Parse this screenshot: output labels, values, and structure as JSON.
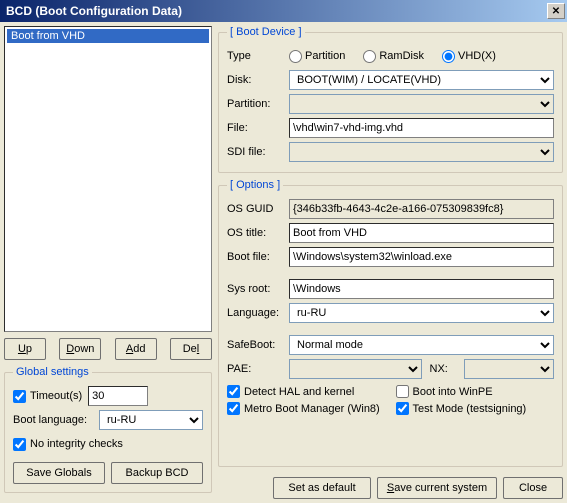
{
  "window": {
    "title": "BCD (Boot Configuration Data)"
  },
  "list": {
    "selected": "Boot from VHD"
  },
  "listButtons": {
    "up": "Up",
    "down": "Down",
    "add": "Add",
    "del": "Del"
  },
  "globalSettings": {
    "legend": "Global settings",
    "timeoutLabel": "Timeout(s)",
    "timeoutValue": "30",
    "timeoutChecked": true,
    "bootLangLabel": "Boot language:",
    "bootLangValue": "ru-RU",
    "noIntegrityLabel": "No integrity checks",
    "noIntegrityChecked": true,
    "saveGlobals": "Save Globals",
    "backupBCD": "Backup BCD"
  },
  "bootDevice": {
    "legend": "[ Boot Device ]",
    "typeLabel": "Type",
    "radios": {
      "partition": "Partition",
      "ramdisk": "RamDisk",
      "vhdx": "VHD(X)"
    },
    "selectedType": "vhdx",
    "diskLabel": "Disk:",
    "diskValue": "BOOT(WIM) / LOCATE(VHD)",
    "partitionLabel": "Partition:",
    "fileLabel": "File:",
    "fileValue": "\\vhd\\win7-vhd-img.vhd",
    "sdiLabel": "SDI file:"
  },
  "options": {
    "legend": "[ Options ]",
    "guidLabel": "OS GUID",
    "guidValue": "{346b33fb-4643-4c2e-a166-075309839fc8}",
    "osTitleLabel": "OS title:",
    "osTitleValue": "Boot from VHD",
    "bootFileLabel": "Boot file:",
    "bootFileValue": "\\Windows\\system32\\winload.exe",
    "sysRootLabel": "Sys root:",
    "sysRootValue": "\\Windows",
    "languageLabel": "Language:",
    "languageValue": "ru-RU",
    "safeBootLabel": "SafeBoot:",
    "safeBootValue": "Normal mode",
    "paeLabel": "PAE:",
    "nxLabel": "NX:",
    "checks": {
      "detectHAL": "Detect HAL and kernel",
      "detectHALChecked": true,
      "bootWinPE": "Boot into WinPE",
      "bootWinPEChecked": false,
      "metroBoot": "Metro Boot Manager (Win8)",
      "metroBootChecked": true,
      "testMode": "Test Mode (testsigning)",
      "testModeChecked": true
    }
  },
  "bottomButtons": {
    "setDefault": "Set as default",
    "saveCurrent": "Save current system",
    "close": "Close"
  }
}
